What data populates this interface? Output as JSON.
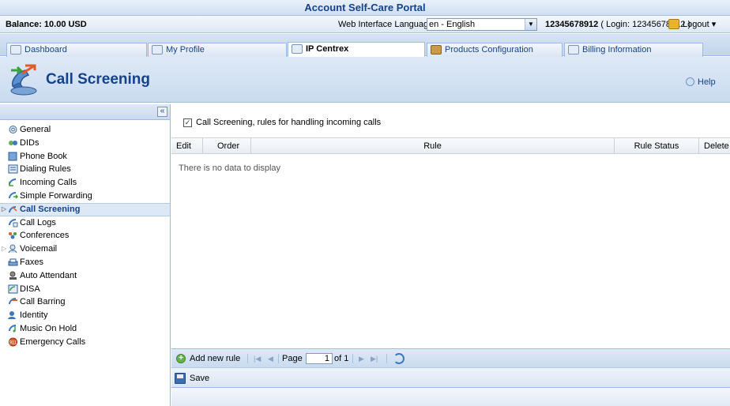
{
  "app": {
    "title": "Account Self-Care Portal"
  },
  "info": {
    "balance": "Balance: 10.00 USD",
    "language_label": "Web Interface Language:",
    "language_value": "en - English",
    "account_number": "12345678912",
    "login_text": "( Login: 12345678912 )",
    "logout": "Logout"
  },
  "tabs": [
    {
      "label": "Dashboard",
      "icon": "dashboard-icon"
    },
    {
      "label": "My Profile",
      "icon": "profile-icon"
    },
    {
      "label": "IP Centrex",
      "icon": "gear-icon",
      "active": true
    },
    {
      "label": "Products Configuration",
      "icon": "products-icon"
    },
    {
      "label": "Billing Information",
      "icon": "billing-icon"
    }
  ],
  "header": {
    "title": "Call Screening",
    "help": "Help"
  },
  "sidebar": {
    "collapse": "«",
    "items": [
      {
        "label": "General"
      },
      {
        "label": "DIDs"
      },
      {
        "label": "Phone Book"
      },
      {
        "label": "Dialing Rules"
      },
      {
        "label": "Incoming Calls"
      },
      {
        "label": "Simple Forwarding"
      },
      {
        "label": "Call Screening",
        "active": true
      },
      {
        "label": "Call Logs"
      },
      {
        "label": "Conferences"
      },
      {
        "label": "Voicemail"
      },
      {
        "label": "Faxes"
      },
      {
        "label": "Auto Attendant"
      },
      {
        "label": "DISA"
      },
      {
        "label": "Call Barring"
      },
      {
        "label": "Identity"
      },
      {
        "label": "Music On Hold"
      },
      {
        "label": "Emergency Calls"
      }
    ]
  },
  "main": {
    "checkbox_label": "Call Screening, rules for handling incoming calls",
    "checkbox_checked": true,
    "columns": [
      "Edit",
      "Order",
      "Rule",
      "Rule Status",
      "Delete"
    ],
    "no_data": "There is no data to display",
    "pager": {
      "add_label": "Add new rule",
      "page_label": "Page",
      "page_value": "1",
      "of_label": "of 1"
    },
    "save_label": "Save"
  },
  "colors": {
    "accent": "#15428b",
    "border": "#99bbe8"
  }
}
